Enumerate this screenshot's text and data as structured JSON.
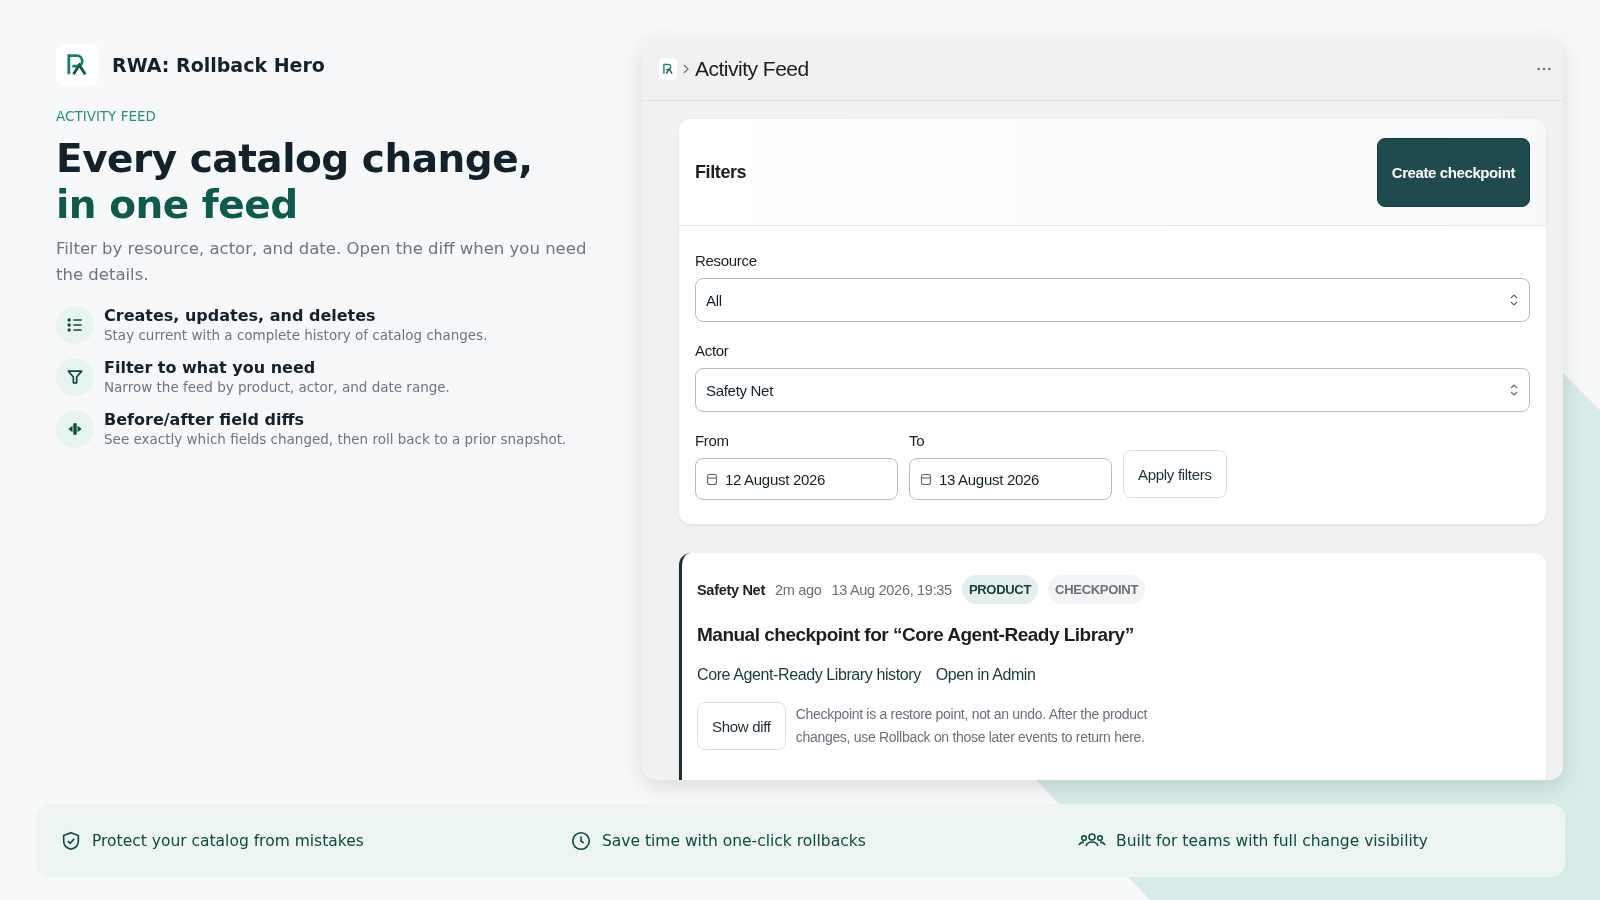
{
  "brand": {
    "name": "RWA: Rollback Hero"
  },
  "hero": {
    "eyebrow": "ACTIVITY FEED",
    "title_line_1": "Every catalog change,",
    "title_line_2": "in one feed",
    "lead": "Filter by resource, actor, and date. Open the diff when you need the details."
  },
  "features": [
    {
      "kind": "list",
      "title": "Creates, updates, and deletes",
      "description": "Stay current with a complete history of catalog changes."
    },
    {
      "kind": "filter",
      "title": "Filter to what you need",
      "description": "Narrow the feed by product, actor, and date range."
    },
    {
      "kind": "diff",
      "title": "Before/after field diffs",
      "description": "See exactly which fields changed, then roll back to a prior snapshot."
    }
  ],
  "app": {
    "breadcrumb": "Activity Feed",
    "filters": {
      "title": "Filters",
      "create_button": "Create checkpoint",
      "resource": {
        "label": "Resource",
        "value": "All"
      },
      "actor": {
        "label": "Actor",
        "value": "Safety Net"
      },
      "from": {
        "label": "From",
        "value": "12 August 2026"
      },
      "to": {
        "label": "To",
        "value": "13 August 2026"
      },
      "apply_button": "Apply filters"
    },
    "events": [
      {
        "actor": "Safety Net",
        "relative_time": "2m ago",
        "timestamp": "13 Aug 2026, 19:35",
        "tags": [
          {
            "label": "PRODUCT",
            "kind": "resource"
          },
          {
            "label": "CHECKPOINT",
            "kind": "action"
          }
        ],
        "title": "Manual checkpoint for “Core Agent-Ready Library”",
        "links": [
          "Core Agent-Ready Library history",
          "Open in Admin"
        ],
        "show_diff_button": "Show diff",
        "note": "Checkpoint is a restore point, not an undo. After the product changes, use Rollback on those later events to return here."
      }
    ]
  },
  "benefits": [
    {
      "kind": "shield",
      "text": "Protect your catalog from mistakes"
    },
    {
      "kind": "clock",
      "text": "Save time with one-click rollbacks"
    },
    {
      "kind": "team",
      "text": "Built for teams with full change visibility"
    }
  ]
}
